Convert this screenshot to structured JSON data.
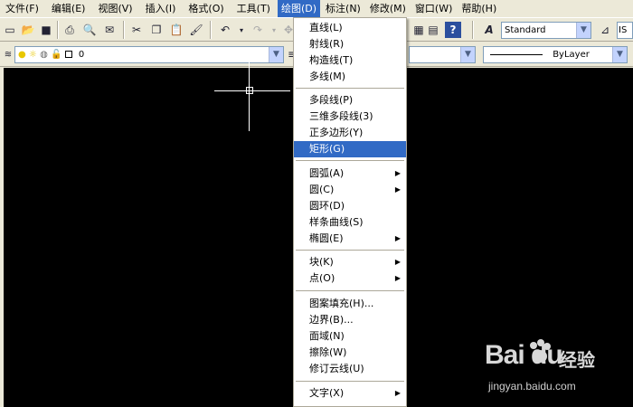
{
  "menubar": {
    "items": [
      "文件(F)",
      "编辑(E)",
      "视图(V)",
      "插入(I)",
      "格式(O)",
      "工具(T)",
      "绘图(D)",
      "标注(N)",
      "修改(M)",
      "窗口(W)",
      "帮助(H)"
    ],
    "active_index": 6
  },
  "toolbar": {
    "text_style": "Standard",
    "dim_style_partial": "IS",
    "layer_name": "0",
    "linetype": "ByLayer"
  },
  "draw_menu": {
    "items": [
      {
        "label": "直线(L)",
        "submenu": false
      },
      {
        "label": "射线(R)",
        "submenu": false
      },
      {
        "label": "构造线(T)",
        "submenu": false
      },
      {
        "label": "多线(M)",
        "submenu": false
      },
      {
        "label": "多段线(P)",
        "submenu": false
      },
      {
        "label": "三维多段线(3)",
        "submenu": false
      },
      {
        "label": "正多边形(Y)",
        "submenu": false
      },
      {
        "label": "矩形(G)",
        "submenu": false,
        "highlighted": true
      },
      {
        "label": "圆弧(A)",
        "submenu": true
      },
      {
        "label": "圆(C)",
        "submenu": true
      },
      {
        "label": "圆环(D)",
        "submenu": false
      },
      {
        "label": "样条曲线(S)",
        "submenu": false
      },
      {
        "label": "椭圆(E)",
        "submenu": true
      },
      {
        "label": "块(K)",
        "submenu": true
      },
      {
        "label": "点(O)",
        "submenu": true
      },
      {
        "label": "图案填充(H)...",
        "submenu": false
      },
      {
        "label": "边界(B)...",
        "submenu": false
      },
      {
        "label": "面域(N)",
        "submenu": false
      },
      {
        "label": "擦除(W)",
        "submenu": false
      },
      {
        "label": "修订云线(U)",
        "submenu": false
      },
      {
        "label": "文字(X)",
        "submenu": true
      }
    ],
    "arrow_glyph": "▶"
  },
  "watermark": {
    "logo": "Bai  du",
    "text": "经验",
    "url": "jingyan.baidu.com"
  },
  "colors": {
    "highlight": "#316ac5",
    "chrome": "#ece9d8",
    "canvas": "#000000"
  }
}
